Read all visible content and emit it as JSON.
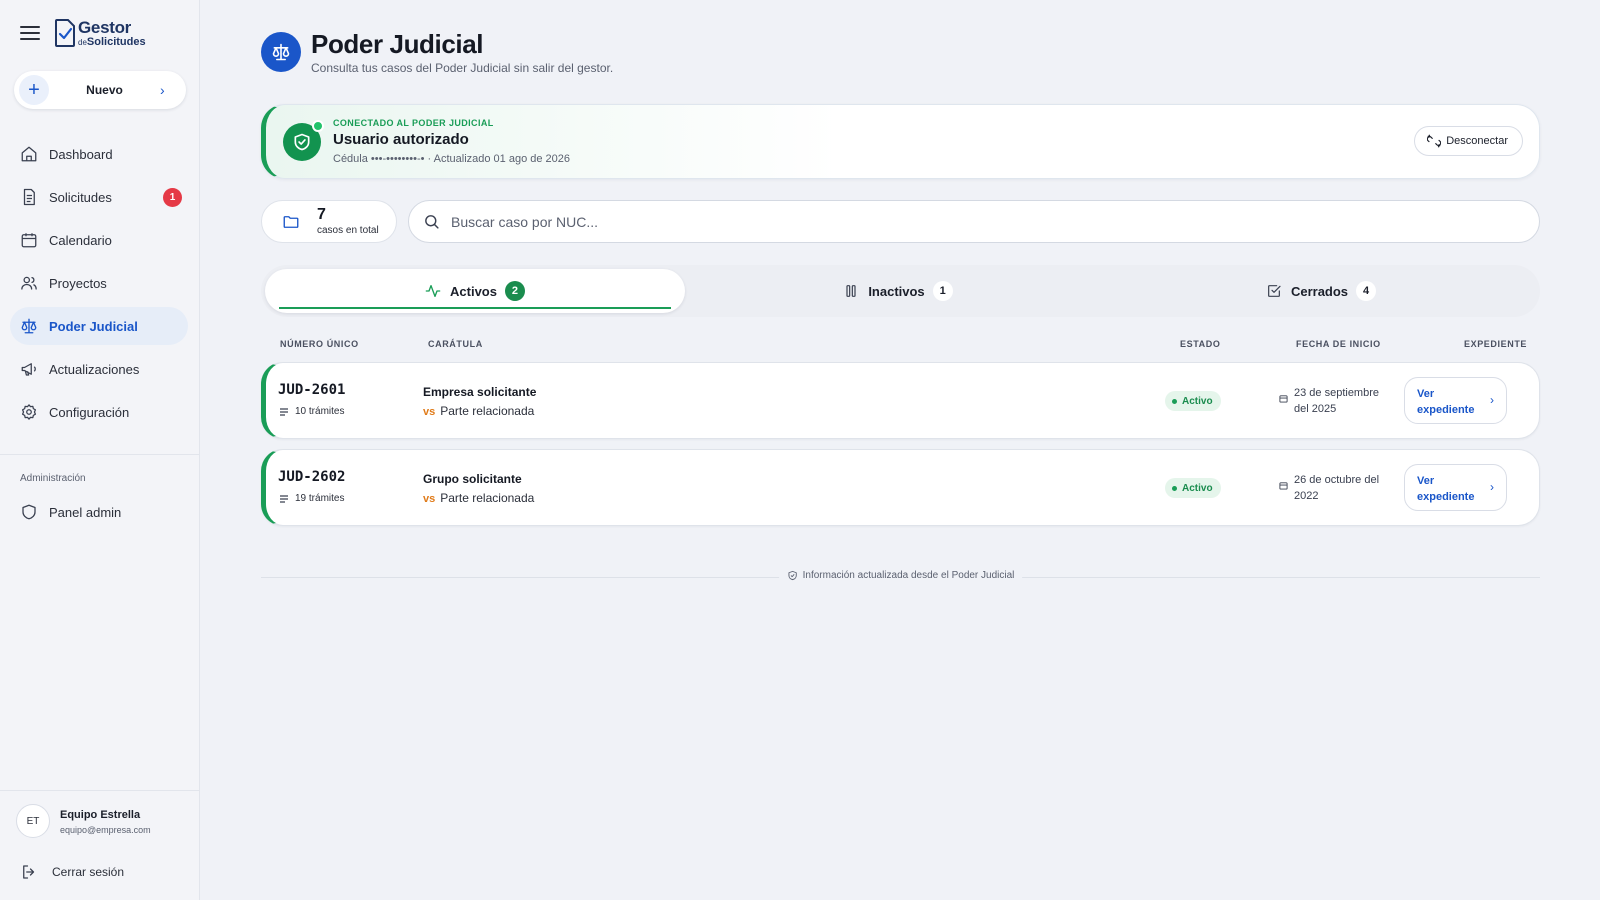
{
  "brand": {
    "line1": "Gestor",
    "line2_small": "de",
    "line2": "Solicitudes"
  },
  "sidebar": {
    "new_label": "Nuevo",
    "items": [
      {
        "label": "Dashboard",
        "icon": "home-icon"
      },
      {
        "label": "Solicitudes",
        "icon": "document-icon",
        "badge": "1"
      },
      {
        "label": "Calendario",
        "icon": "calendar-icon"
      },
      {
        "label": "Proyectos",
        "icon": "users-icon"
      },
      {
        "label": "Poder Judicial",
        "icon": "scales-icon",
        "active": true
      },
      {
        "label": "Actualizaciones",
        "icon": "megaphone-icon"
      },
      {
        "label": "Configuración",
        "icon": "gear-icon"
      }
    ],
    "admin_section": "Administración",
    "admin_item": "Panel admin",
    "user": {
      "initials": "ET",
      "name": "Equipo Estrella",
      "email": "equipo@empresa.com"
    },
    "logout": "Cerrar sesión"
  },
  "header": {
    "title": "Poder Judicial",
    "subtitle": "Consulta tus casos del Poder Judicial sin salir del gestor."
  },
  "connection": {
    "kicker": "CONECTADO AL PODER JUDICIAL",
    "title": "Usuario autorizado",
    "meta": "Cédula •••-••••••••-• · Actualizado 01 ago de 2026",
    "disconnect": "Desconectar"
  },
  "summary": {
    "count": "7",
    "label": "casos en total"
  },
  "search": {
    "placeholder": "Buscar caso por NUC..."
  },
  "tabs": [
    {
      "label": "Activos",
      "count": "2",
      "icon": "activity-icon"
    },
    {
      "label": "Inactivos",
      "count": "1",
      "icon": "pause-icon"
    },
    {
      "label": "Cerrados",
      "count": "4",
      "icon": "check-square-icon"
    }
  ],
  "table": {
    "headers": [
      "NÚMERO ÚNICO",
      "CARÁTULA",
      "ESTADO",
      "FECHA DE INICIO",
      "EXPEDIENTE"
    ],
    "vs": "vs",
    "rows": [
      {
        "nuc": "JUD-2601",
        "tramites": "10 trámites",
        "party1": "Empresa solicitante",
        "party2": "Parte relacionada",
        "status": "Activo",
        "date": "23 de septiembre del 2025",
        "action": "Ver expediente"
      },
      {
        "nuc": "JUD-2602",
        "tramites": "19 trámites",
        "party1": "Grupo solicitante",
        "party2": "Parte relacionada",
        "status": "Activo",
        "date": "26 de octubre del 2022",
        "action": "Ver expediente"
      }
    ]
  },
  "footer_note": "Información actualizada desde el Poder Judicial",
  "colors": {
    "primary": "#1a56c9",
    "success": "#1a9d57",
    "danger": "#e53946",
    "accent_vs": "#e07b1a"
  }
}
